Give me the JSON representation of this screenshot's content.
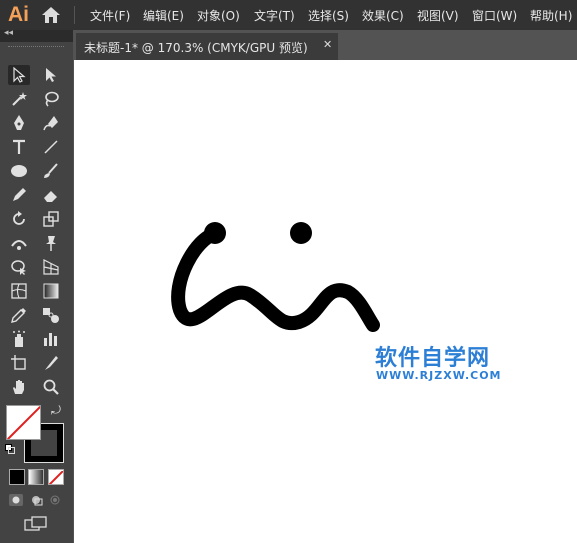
{
  "app": {
    "logo": "Ai"
  },
  "menu": [
    "文件(F)",
    "编辑(E)",
    "对象(O)",
    "文字(T)",
    "选择(S)",
    "效果(C)",
    "视图(V)",
    "窗口(W)",
    "帮助(H)"
  ],
  "document_tab": {
    "title": "未标题-1* @ 170.3% (CMYK/GPU 预览)",
    "close": "✕"
  },
  "panel_collapse": "◂◂",
  "watermark": {
    "name": "软件自学网",
    "url": "WWW.RJZXW.COM"
  },
  "colors": {
    "accent_logo": "#f4a259",
    "watermark": "#2d7fd6",
    "stroke": "#000000",
    "none_slash": "#e02020"
  }
}
